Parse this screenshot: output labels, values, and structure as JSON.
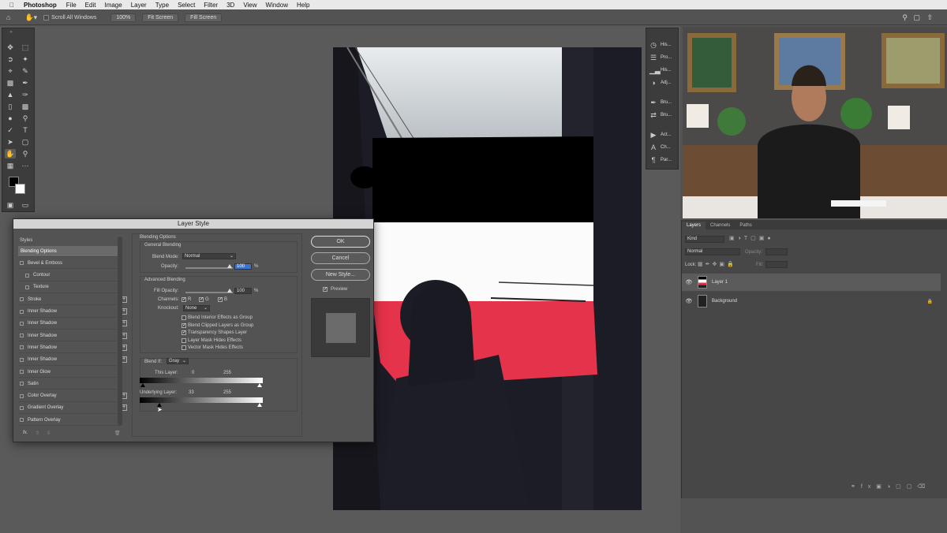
{
  "menubar": {
    "apple": "",
    "app": "Photoshop",
    "items": [
      "File",
      "Edit",
      "Image",
      "Layer",
      "Type",
      "Select",
      "Filter",
      "3D",
      "View",
      "Window",
      "Help"
    ]
  },
  "options": {
    "scroll_all": "Scroll All Windows",
    "zoom": "100%",
    "fit_screen": "Fit Screen",
    "fill_screen": "Fill Screen"
  },
  "dock": {
    "items": [
      {
        "icon": "history-icon",
        "label": "His..."
      },
      {
        "icon": "properties-icon",
        "label": "Pro..."
      },
      {
        "icon": "histogram-icon",
        "label": "His..."
      },
      {
        "icon": "adjustments-icon",
        "label": "Adj..."
      },
      {
        "icon": "brush-icon",
        "label": "Bru..."
      },
      {
        "icon": "brush-settings-icon",
        "label": "Bru..."
      },
      {
        "icon": "actions-icon",
        "label": "Act..."
      },
      {
        "icon": "character-icon",
        "label": "Ch..."
      },
      {
        "icon": "paragraph-icon",
        "label": "Par..."
      }
    ]
  },
  "layers_panel": {
    "tabs": [
      "Layers",
      "Channels",
      "Paths"
    ],
    "kind": "Kind",
    "blend": "Normal",
    "opacity_label": "Opacity:",
    "lock_label": "Lock:",
    "fill_label": "Fill:",
    "layers": [
      {
        "name": "Layer 1",
        "selected": true
      },
      {
        "name": "Background",
        "selected": false
      }
    ]
  },
  "dialog": {
    "title": "Layer Style",
    "styles_header": "Styles",
    "styles": [
      {
        "label": "Blending Options",
        "check": false,
        "plus": false,
        "selected": true,
        "indent": 0
      },
      {
        "label": "Bevel & Emboss",
        "check": true,
        "plus": false,
        "selected": false,
        "indent": 0
      },
      {
        "label": "Contour",
        "check": true,
        "plus": false,
        "selected": false,
        "indent": 1
      },
      {
        "label": "Texture",
        "check": true,
        "plus": false,
        "selected": false,
        "indent": 1
      },
      {
        "label": "Stroke",
        "check": true,
        "plus": true,
        "selected": false,
        "indent": 0
      },
      {
        "label": "Inner Shadow",
        "check": true,
        "plus": true,
        "selected": false,
        "indent": 0
      },
      {
        "label": "Inner Shadow",
        "check": true,
        "plus": true,
        "selected": false,
        "indent": 0
      },
      {
        "label": "Inner Shadow",
        "check": true,
        "plus": true,
        "selected": false,
        "indent": 0
      },
      {
        "label": "Inner Shadow",
        "check": true,
        "plus": true,
        "selected": false,
        "indent": 0
      },
      {
        "label": "Inner Shadow",
        "check": true,
        "plus": true,
        "selected": false,
        "indent": 0
      },
      {
        "label": "Inner Glow",
        "check": true,
        "plus": false,
        "selected": false,
        "indent": 0
      },
      {
        "label": "Satin",
        "check": true,
        "plus": false,
        "selected": false,
        "indent": 0
      },
      {
        "label": "Color Overlay",
        "check": true,
        "plus": true,
        "selected": false,
        "indent": 0
      },
      {
        "label": "Gradient Overlay",
        "check": true,
        "plus": true,
        "selected": false,
        "indent": 0
      },
      {
        "label": "Pattern Overlay",
        "check": true,
        "plus": false,
        "selected": false,
        "indent": 0
      }
    ],
    "fx": "fx.",
    "blending_options": "Blending Options",
    "general_blending": "General Blending",
    "blend_mode_label": "Blend Mode:",
    "blend_mode_value": "Normal",
    "opacity_label": "Opacity:",
    "opacity_value": "100",
    "percent": "%",
    "advanced_blending": "Advanced Blending",
    "fill_opacity_label": "Fill Opacity:",
    "fill_opacity_value": "100",
    "channels_label": "Channels:",
    "channel_r": "R",
    "channel_g": "G",
    "channel_b": "B",
    "knockout_label": "Knockout:",
    "knockout_value": "None",
    "adv_checks": [
      {
        "label": "Blend Interior Effects as Group",
        "checked": false
      },
      {
        "label": "Blend Clipped Layers as Group",
        "checked": true
      },
      {
        "label": "Transparency Shapes Layer",
        "checked": true
      },
      {
        "label": "Layer Mask Hides Effects",
        "checked": false
      },
      {
        "label": "Vector Mask Hides Effects",
        "checked": false
      }
    ],
    "blend_if_label": "Blend If:",
    "blend_if_value": "Gray",
    "this_layer_label": "This Layer:",
    "this_layer_low": "0",
    "this_layer_high": "255",
    "underlying_label": "Underlying Layer:",
    "underlying_low": "33",
    "underlying_high": "255",
    "ok": "OK",
    "cancel": "Cancel",
    "new_style": "New Style...",
    "preview": "Preview"
  }
}
